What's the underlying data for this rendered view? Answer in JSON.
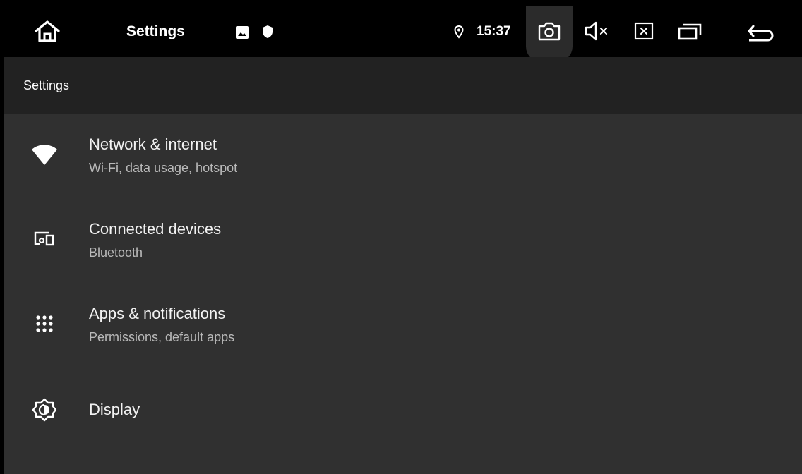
{
  "status_bar": {
    "title": "Settings",
    "time": "15:37",
    "icons": {
      "home": "home-icon",
      "notification_1": "image-icon",
      "notification_2": "shield-icon",
      "location": "location-pin-icon",
      "camera": "screenshot-camera-icon",
      "mute": "volume-muted-icon",
      "close": "close-box-icon",
      "recents": "recent-apps-icon",
      "back": "back-arrow-icon"
    }
  },
  "app_bar": {
    "title": "Settings"
  },
  "settings_items": [
    {
      "title": "Network & internet",
      "subtitle": "Wi-Fi, data usage, hotspot",
      "icon": "wifi-icon"
    },
    {
      "title": "Connected devices",
      "subtitle": "Bluetooth",
      "icon": "connected-devices-icon"
    },
    {
      "title": "Apps & notifications",
      "subtitle": "Permissions, default apps",
      "icon": "apps-grid-icon"
    },
    {
      "title": "Display",
      "icon": "brightness-icon"
    }
  ],
  "colors": {
    "status_bar_bg": "#000000",
    "app_bar_bg": "#222222",
    "content_bg": "#303030",
    "title_text": "#f2f2f2",
    "subtitle_text": "#b9b9b9"
  }
}
